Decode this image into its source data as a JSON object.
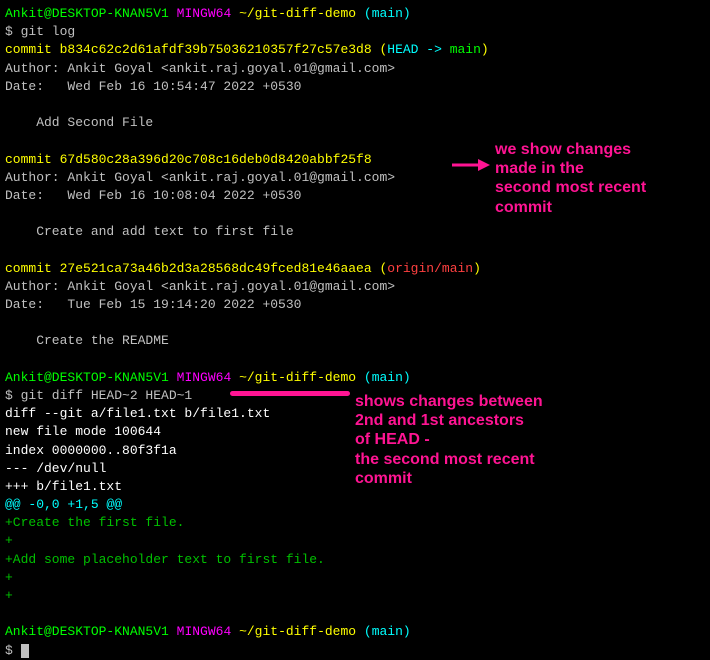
{
  "prompt1": {
    "user": "Ankit@DESKTOP-KNAN5V1",
    "mingw": "MINGW64",
    "path": "~/git-diff-demo",
    "branch": "(main)"
  },
  "cmd1": "$ git log",
  "commit1": {
    "prefix": "commit ",
    "hash": "b834c62c2d61afdf39b75036210357f27c57e3d8",
    "head_open": " (",
    "head_label": "HEAD -> ",
    "head_branch": "main",
    "head_close": ")",
    "author": "Author: Ankit Goyal <ankit.raj.goyal.01@gmail.com>",
    "date": "Date:   Wed Feb 16 10:54:47 2022 +0530",
    "msg": "    Add Second File"
  },
  "commit2": {
    "prefix": "commit ",
    "hash": "67d580c28a396d20c708c16deb0d8420abbf25f8",
    "author": "Author: Ankit Goyal <ankit.raj.goyal.01@gmail.com>",
    "date": "Date:   Wed Feb 16 10:08:04 2022 +0530",
    "msg": "    Create and add text to first file"
  },
  "commit3": {
    "prefix": "commit ",
    "hash": "27e521ca73a46b2d3a28568dc49fced81e46aaea",
    "remote_open": " (",
    "remote": "origin/main",
    "remote_close": ")",
    "author": "Author: Ankit Goyal <ankit.raj.goyal.01@gmail.com>",
    "date": "Date:   Tue Feb 15 19:14:20 2022 +0530",
    "msg": "    Create the README"
  },
  "cmd2": "$ git diff HEAD~2 HEAD~1",
  "diff": {
    "header": "diff --git a/file1.txt b/file1.txt",
    "newfile": "new file mode 100644",
    "index": "index 0000000..80f3f1a",
    "minus": "--- /dev/null",
    "plus": "+++ b/file1.txt",
    "hunk": "@@ -0,0 +1,5 @@",
    "add1": "+Create the first file.",
    "add2": "+",
    "add3": "+Add some placeholder text to first file.",
    "add4": "+",
    "add5": "+"
  },
  "cmd3": "$ ",
  "annotation1": "we show changes\nmade in the\nsecond most recent\ncommit",
  "annotation2": "shows changes between\n2nd and 1st ancestors\nof HEAD -\nthe second most recent\ncommit"
}
